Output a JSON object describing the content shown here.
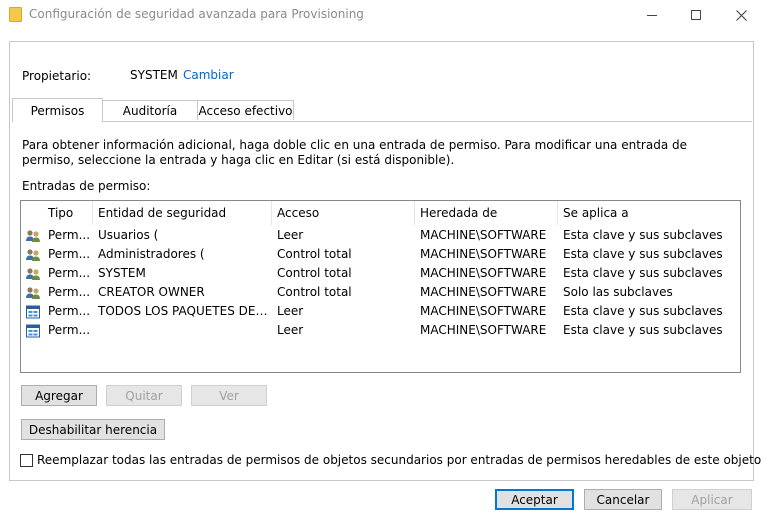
{
  "window": {
    "title": "Configuración de seguridad avanzada para Provisioning"
  },
  "owner": {
    "label": "Propietario:",
    "value": "SYSTEM",
    "change_link": "Cambiar"
  },
  "tabs": [
    {
      "label": "Permisos",
      "active": true
    },
    {
      "label": "Auditoría",
      "active": false
    },
    {
      "label": "Acceso efectivo",
      "active": false
    }
  ],
  "info_text": "Para obtener información adicional, haga doble clic en una entrada de permiso. Para modificar una entrada de permiso, seleccione la entrada y haga clic en Editar (si está disponible).",
  "entries_label": "Entradas de permiso:",
  "columns": [
    "Tipo",
    "Entidad de seguridad",
    "Acceso",
    "Heredada de",
    "Se aplica a"
  ],
  "rows": [
    {
      "icon": "user-group-icon",
      "tipo": "Perm...",
      "entidad": "Usuarios (",
      "acceso": "Leer",
      "heredada": "MACHINE\\SOFTWARE",
      "aplica": "Esta clave y sus subclaves"
    },
    {
      "icon": "user-group-icon",
      "tipo": "Perm...",
      "entidad": "Administradores (",
      "acceso": "Control total",
      "heredada": "MACHINE\\SOFTWARE",
      "aplica": "Esta clave y sus subclaves"
    },
    {
      "icon": "user-group-icon",
      "tipo": "Perm...",
      "entidad": "SYSTEM",
      "acceso": "Control total",
      "heredada": "MACHINE\\SOFTWARE",
      "aplica": "Esta clave y sus subclaves"
    },
    {
      "icon": "user-group-icon",
      "tipo": "Perm...",
      "entidad": "CREATOR OWNER",
      "acceso": "Control total",
      "heredada": "MACHINE\\SOFTWARE",
      "aplica": "Solo las subclaves"
    },
    {
      "icon": "app-package-icon",
      "tipo": "Perm...",
      "entidad": "TODOS LOS PAQUETES DE AP...",
      "acceso": "Leer",
      "heredada": "MACHINE\\SOFTWARE",
      "aplica": "Esta clave y sus subclaves"
    },
    {
      "icon": "app-package-icon",
      "tipo": "Perm...",
      "entidad": "",
      "acceso": "Leer",
      "heredada": "MACHINE\\SOFTWARE",
      "aplica": "Esta clave y sus subclaves"
    }
  ],
  "buttons": {
    "add": "Agregar",
    "remove": "Quitar",
    "view": "Ver",
    "disable_inheritance": "Deshabilitar herencia",
    "accept": "Aceptar",
    "cancel": "Cancelar",
    "apply": "Aplicar"
  },
  "replace_checkbox": {
    "label": "Reemplazar todas las entradas de permisos de objetos secundarios por entradas de permisos heredables de este objeto",
    "checked": false
  }
}
